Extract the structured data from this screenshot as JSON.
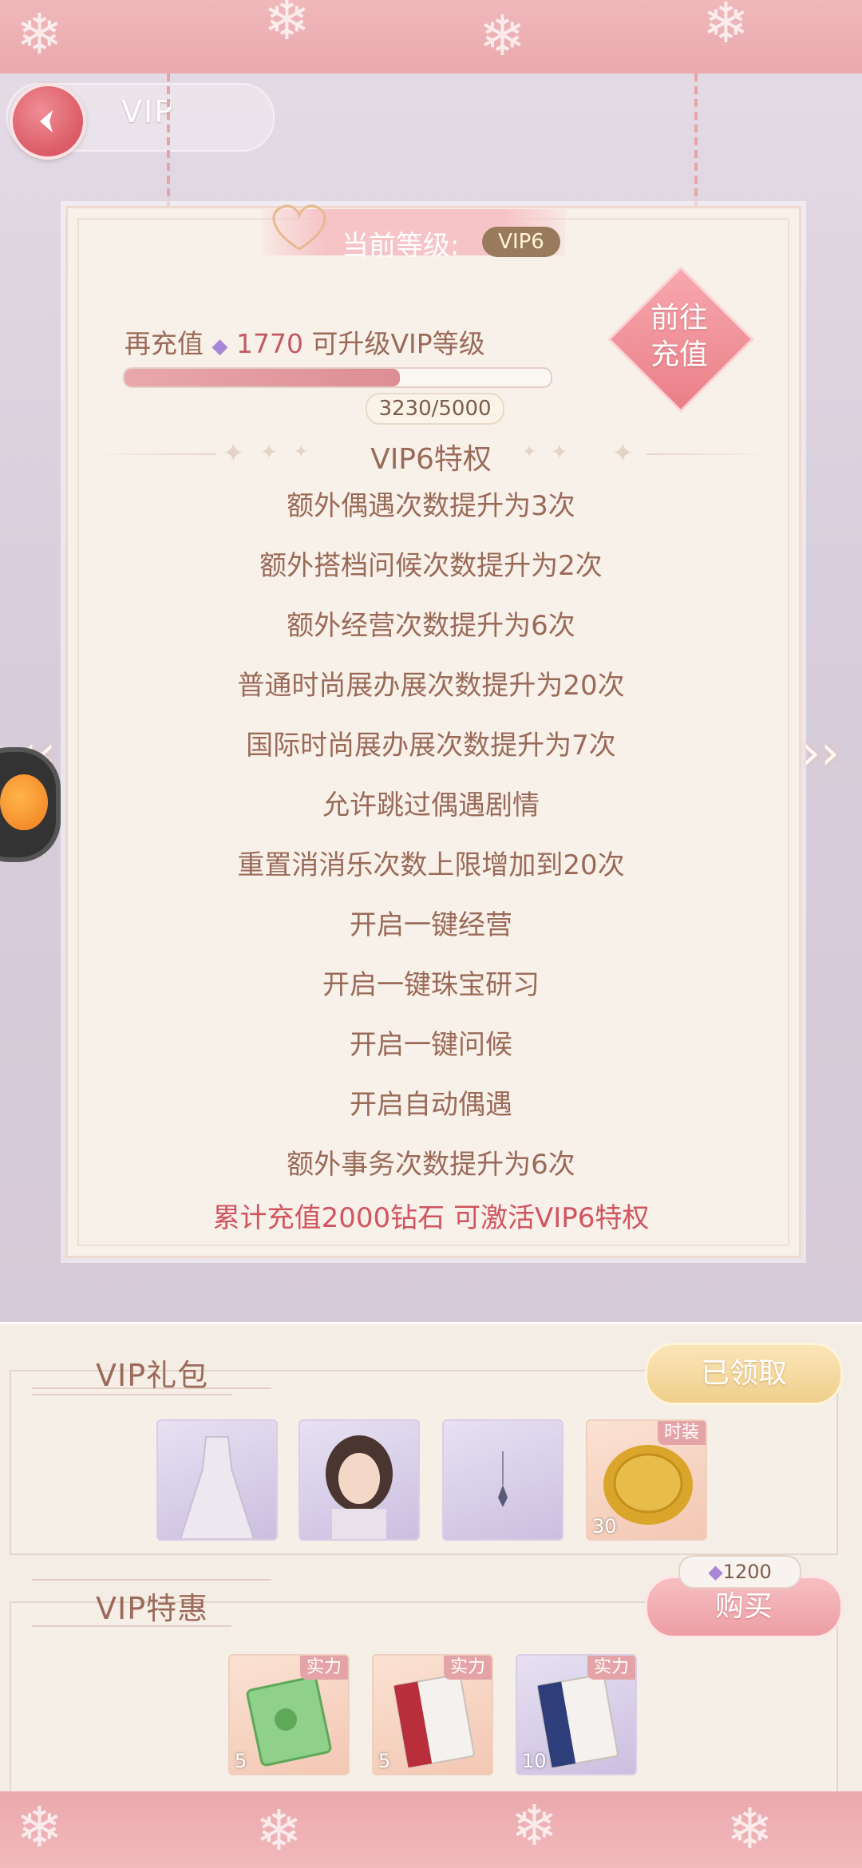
{
  "header": {
    "title": "VIP"
  },
  "vip": {
    "current_level_label": "当前等级:",
    "current_level": "VIP6",
    "recharge_prefix": "再充值",
    "recharge_amount": "1770",
    "recharge_suffix": "可升级VIP等级",
    "progress_text": "3230/5000",
    "progress_fraction": 0.646,
    "goto_line1": "前往",
    "goto_line2": "充值",
    "privilege_title": "VIP6特权",
    "privileges": [
      "额外偶遇次数提升为3次",
      "额外搭档问候次数提升为2次",
      "额外经营次数提升为6次",
      "普通时尚展办展次数提升为20次",
      "国际时尚展办展次数提升为7次",
      "允许跳过偶遇剧情",
      "重置消消乐次数上限增加到20次",
      "开启一键经营",
      "开启一键珠宝研习",
      "开启一键问候",
      "开启自动偶遇",
      "额外事务次数提升为6次"
    ],
    "activate_note": "累计充值2000钻石 可激活VIP6特权"
  },
  "gift_pack": {
    "title": "VIP礼包",
    "button": "已领取",
    "items": [
      {
        "icon": "dress-item-icon",
        "tag": "",
        "count": ""
      },
      {
        "icon": "hairstyle-item-icon",
        "tag": "",
        "count": ""
      },
      {
        "icon": "earring-item-icon",
        "tag": "",
        "count": ""
      },
      {
        "icon": "gold-coin-item-icon",
        "tag": "时装",
        "count": "30"
      }
    ]
  },
  "special_offer": {
    "title": "VIP特惠",
    "price": "1200",
    "button": "购买",
    "items": [
      {
        "icon": "green-book-icon",
        "tag": "实力",
        "count": "5"
      },
      {
        "icon": "red-book-icon",
        "tag": "实力",
        "count": "5"
      },
      {
        "icon": "blue-book-icon",
        "tag": "实力",
        "count": "10"
      }
    ]
  },
  "colors": {
    "accent_pink": "#e9a9ad",
    "text_brown": "#9a6a58",
    "highlight_red": "#d0555f"
  }
}
